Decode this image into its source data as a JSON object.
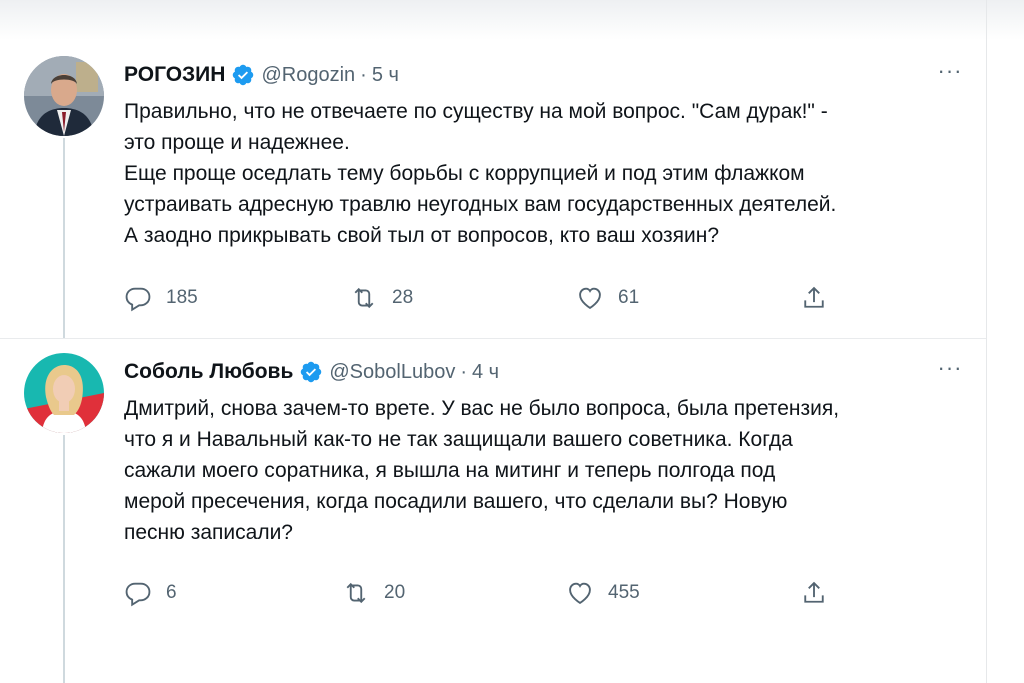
{
  "tweets": [
    {
      "name": "РОГОЗИН",
      "handle": "@Rogozin",
      "dot": "·",
      "time": "5 ч",
      "more": "···",
      "text": "Правильно, что не отвечаете по существу на мой вопрос. \"Сам дурак!\" -\nэто проще и надежнее.\nЕще проще оседлать тему борьбы с коррупцией и под этим флажком\nустраивать адресную травлю неугодных вам государственных деятелей.\nА заодно прикрывать свой тыл от вопросов, кто ваш хозяин?",
      "reply_count": "185",
      "retweet_count": "28",
      "like_count": "61",
      "avatar_icon": "portrait-man-in-suit"
    },
    {
      "name": "Соболь Любовь",
      "handle": "@SobolLubov",
      "dot": "·",
      "time": "4 ч",
      "more": "···",
      "text": "Дмитрий, снова зачем-то врете. У вас не было вопроса, была претензия,\nчто я и Навальный как-то не так защищали вашего советника. Когда\nсажали моего соратника, я вышла на митинг и теперь полгода под\nмерой пресечения, когда посадили вашего, что сделали вы? Новую\nпесню записали?",
      "reply_count": "6",
      "retweet_count": "20",
      "like_count": "455",
      "avatar_icon": "portrait-woman-on-teal"
    }
  ],
  "colors": {
    "verified": "#1d9bf0",
    "text": "#0f1419",
    "muted": "#536471",
    "thread_line": "#cfd9de"
  },
  "icons": [
    "verified-badge-icon",
    "reply-icon",
    "retweet-icon",
    "like-icon",
    "share-icon",
    "more-icon"
  ]
}
